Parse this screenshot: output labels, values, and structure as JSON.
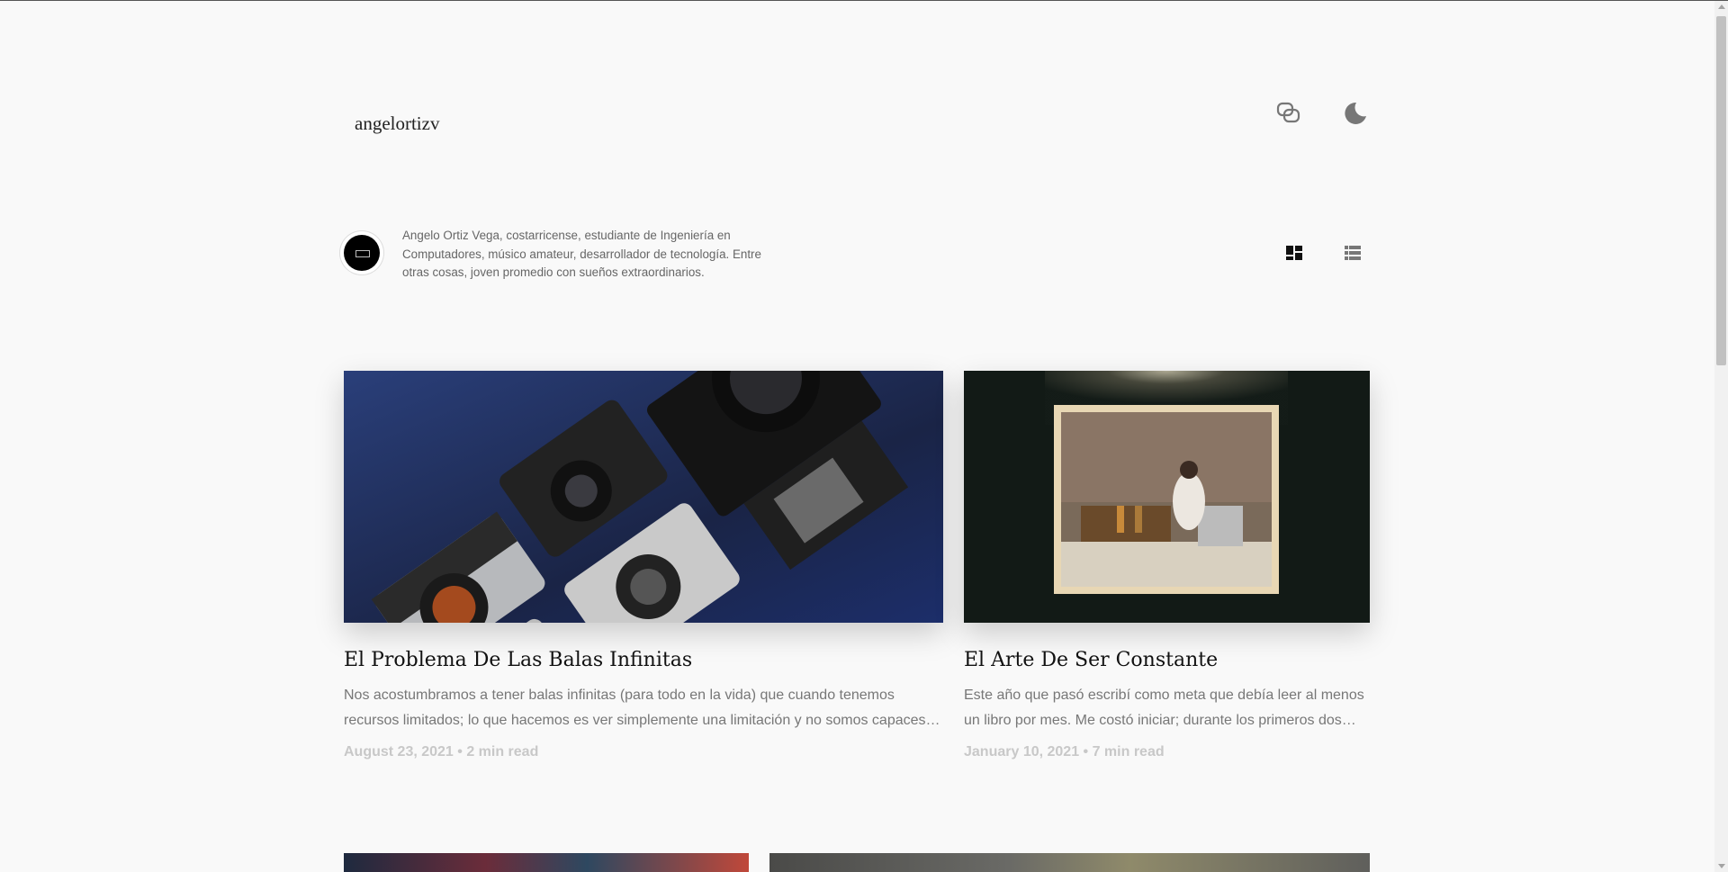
{
  "header": {
    "site_title": "angelortizv",
    "icons": [
      "theme-toggle-icon",
      "moon-icon"
    ]
  },
  "profile": {
    "bio": "Angelo Ortiz Vega, costarricense, estudiante de Ingeniería en Computadores, músico amateur, desarrollador de tecnología. Entre otras cosas, joven promedio con sueños extraordinarios."
  },
  "view_toggle": {
    "icons": [
      "grid-view-icon",
      "list-view-icon"
    ]
  },
  "posts": [
    {
      "title": "El Problema De Las Balas Infinitas",
      "excerpt": "Nos acostumbramos a tener balas infinitas (para todo en la vida) que cuando tenemos recursos limitados; lo que hacemos es ver simplemente una limitación y no somos capaces…",
      "meta": "August 23, 2021 • 2 min read"
    },
    {
      "title": "El Arte De Ser Constante",
      "excerpt": "Este año que pasó escribí como meta que debía leer al menos un libro por mes. Me costó iniciar; durante los primeros dos…",
      "meta": "January 10, 2021 • 7 min read"
    }
  ],
  "colors": {
    "background": "#f9f9f9",
    "title_text": "#111111",
    "excerpt_text": "#777777",
    "meta_text": "#c8c8c8"
  }
}
